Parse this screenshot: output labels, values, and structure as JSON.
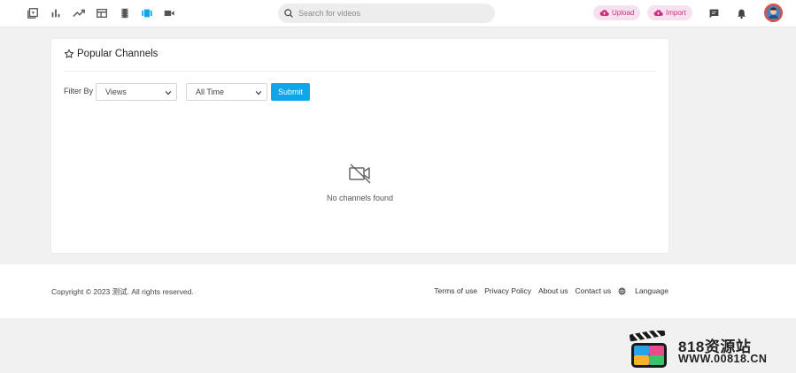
{
  "header": {
    "nav_icons": [
      "video-library-icon",
      "bar-chart-icon",
      "trending-icon",
      "layout-icon",
      "film-icon",
      "channels-icon",
      "camera-icon"
    ],
    "search": {
      "placeholder": "Search for videos"
    },
    "upload_label": "Upload",
    "import_label": "Import",
    "accent": "#c8327e",
    "active_color": "#0ea5e9"
  },
  "card": {
    "title": "Popular Channels",
    "filter_label": "Filter By",
    "filter_select": {
      "selected": "Views"
    },
    "period_select": {
      "selected": "All Time"
    },
    "submit_label": "Submit",
    "empty_text": "No channels found"
  },
  "footer": {
    "copyright": "Copyright © 2023 测试. All rights reserved.",
    "links": [
      "Terms of use",
      "Privacy Policy",
      "About us",
      "Contact us"
    ],
    "language_label": "Language"
  },
  "watermark": {
    "line1": "818资源站",
    "line2": "WWW.00818.CN"
  }
}
